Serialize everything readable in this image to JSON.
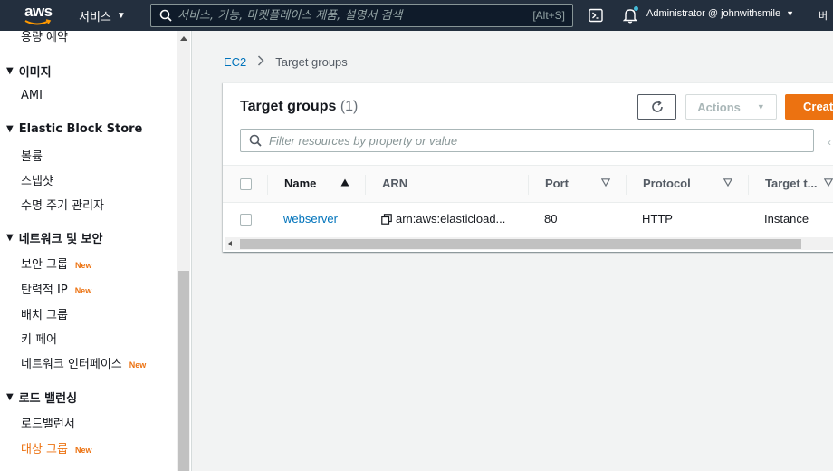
{
  "topnav": {
    "logo_text": "aws",
    "services_label": "서비스",
    "search_placeholder": "서비스, 기능, 마켓플레이스 제품, 설명서 검색",
    "search_shortcut": "[Alt+S]",
    "account_label": "Administrator @ johnwithsmile",
    "region_label": "버"
  },
  "sidebar": {
    "items": [
      {
        "type": "item",
        "label": "용량 예약"
      },
      {
        "type": "head",
        "label": "이미지"
      },
      {
        "type": "item",
        "label": "AMI"
      },
      {
        "type": "head",
        "label": "Elastic Block Store"
      },
      {
        "type": "item",
        "label": "볼륨"
      },
      {
        "type": "item",
        "label": "스냅샷"
      },
      {
        "type": "item",
        "label": "수명 주기 관리자"
      },
      {
        "type": "head",
        "label": "네트워크 및 보안"
      },
      {
        "type": "item",
        "label": "보안 그룹",
        "badge": "New"
      },
      {
        "type": "item",
        "label": "탄력적 IP",
        "badge": "New"
      },
      {
        "type": "item",
        "label": "배치 그룹"
      },
      {
        "type": "item",
        "label": "키 페어"
      },
      {
        "type": "item",
        "label": "네트워크 인터페이스",
        "badge": "New"
      },
      {
        "type": "head",
        "label": "로드 밸런싱"
      },
      {
        "type": "item",
        "label": "로드밸런서"
      },
      {
        "type": "item",
        "label": "대상 그룹",
        "badge": "New",
        "active": true
      }
    ]
  },
  "breadcrumb": {
    "root": "EC2",
    "current": "Target groups"
  },
  "panel": {
    "title": "Target groups",
    "count": "(1)",
    "actions_label": "Actions",
    "create_label": "Create target group",
    "filter_placeholder": "Filter resources by property or value"
  },
  "table": {
    "columns": [
      "Name",
      "ARN",
      "Port",
      "Protocol",
      "Target type"
    ],
    "column_display": [
      "Name",
      "ARN",
      "Port",
      "Protocol",
      "Target t..."
    ],
    "rows": [
      {
        "name": "webserver",
        "arn": "arn:aws:elasticload...",
        "port": "80",
        "protocol": "HTTP",
        "target_type": "Instance"
      }
    ]
  },
  "colors": {
    "nav_bg": "#232f3e",
    "accent_orange": "#ec7211",
    "link_blue": "#0073bb"
  }
}
